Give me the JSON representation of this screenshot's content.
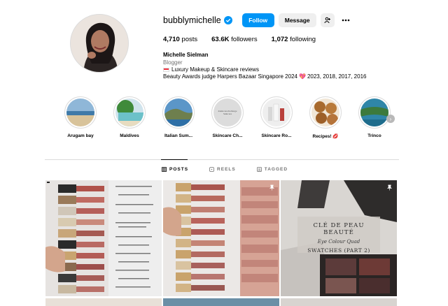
{
  "profile": {
    "username": "bubblymichelle",
    "verified": true,
    "follow_label": "Follow",
    "message_label": "Message",
    "stats": {
      "posts": "4,710",
      "posts_label": "posts",
      "followers": "63.6K",
      "followers_label": "followers",
      "following": "1,072",
      "following_label": "following"
    },
    "full_name": "Michelle Sielman",
    "category": "Blogger",
    "bio_line1": "Luxury Makeup & Skincare reviews",
    "bio_line2_a": "Beauty Awards judge Harpers Bazaar Singapore 2024",
    "bio_line2_b": "2023, 2018, 2017, 2016"
  },
  "highlights": [
    {
      "label": "Arugam bay"
    },
    {
      "label": "Maldives"
    },
    {
      "label": "Italian Sum..."
    },
    {
      "label": "Skincare Ch...",
      "cover_text": "#skincarechallenge Skincare"
    },
    {
      "label": "Skincare Ro..."
    },
    {
      "label": "Recipes! 💋"
    },
    {
      "label": "Trinco"
    }
  ],
  "tabs": [
    {
      "label": "POSTS",
      "active": true
    },
    {
      "label": "REELS",
      "active": false
    },
    {
      "label": "TAGGED",
      "active": false
    }
  ],
  "posts": [
    {
      "pinned": false
    },
    {
      "pinned": true
    },
    {
      "pinned": true,
      "title": "CLÉ DE PEAU BEAUTÉ",
      "subtitle": "Eye Colour Quad",
      "line3": "SWATCHES (PART 2)"
    }
  ],
  "colors": {
    "accent": "#0095f6",
    "verified": "#0095f6",
    "muted_text": "#737373",
    "border": "#dbdbdb"
  }
}
